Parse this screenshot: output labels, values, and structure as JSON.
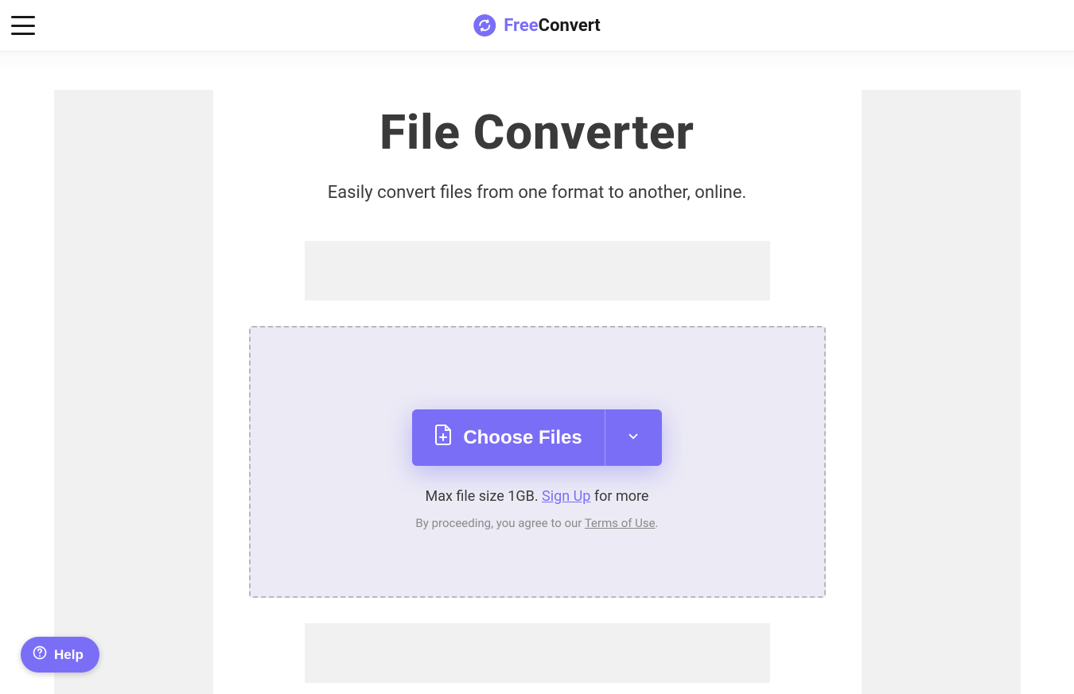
{
  "header": {
    "logo_free": "Free",
    "logo_convert": "Convert"
  },
  "main": {
    "title": "File Converter",
    "subtitle": "Easily convert files from one format to another, online."
  },
  "dropzone": {
    "choose_label": "Choose Files",
    "info_prefix": "Max file size 1GB. ",
    "signup_label": "Sign Up",
    "info_suffix": " for more",
    "terms_prefix": "By proceeding, you agree to our ",
    "terms_link": "Terms of Use",
    "terms_suffix": "."
  },
  "help": {
    "label": "Help"
  },
  "colors": {
    "accent": "#7B6EF6"
  }
}
